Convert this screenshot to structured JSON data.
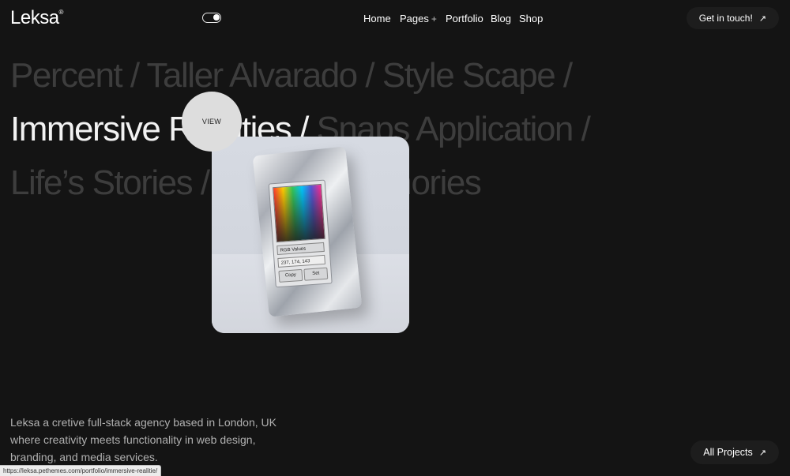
{
  "header": {
    "logo": "Leksa",
    "logo_mark": "®",
    "nav": [
      {
        "label": "Home"
      },
      {
        "label": "Pages",
        "suffix": "+"
      },
      {
        "label": "Portfolio"
      },
      {
        "label": "Blog"
      },
      {
        "label": "Shop"
      }
    ],
    "cta": "Get in touch!",
    "cta_icon": "arrow-up-right-icon",
    "toggle_icon": "theme-toggle-icon"
  },
  "projects": [
    {
      "title": "Percent",
      "active": false
    },
    {
      "title": "Taller Alvarado",
      "active": false
    },
    {
      "title": "Style Scape",
      "active": false
    },
    {
      "title": "Immersive Realities",
      "active": true
    },
    {
      "title": "Snaps Application",
      "active": false
    },
    {
      "title": "Life’s Stories",
      "active": false
    },
    {
      "title": "Sharing Memories",
      "active": false
    }
  ],
  "separator": "/",
  "preview": {
    "badge": "VIEW",
    "widget": {
      "select": "RGB Values",
      "value": "237, 174, 143",
      "copy": "Copy",
      "set": "Set"
    }
  },
  "about": "Leksa a cretive full-stack agency based in London, UK where creativity meets functionality in web design, branding, and media services.",
  "all_projects": "All Projects",
  "status_url": "https://leksa.pethemes.com/portfolio/immersive-realitie/"
}
